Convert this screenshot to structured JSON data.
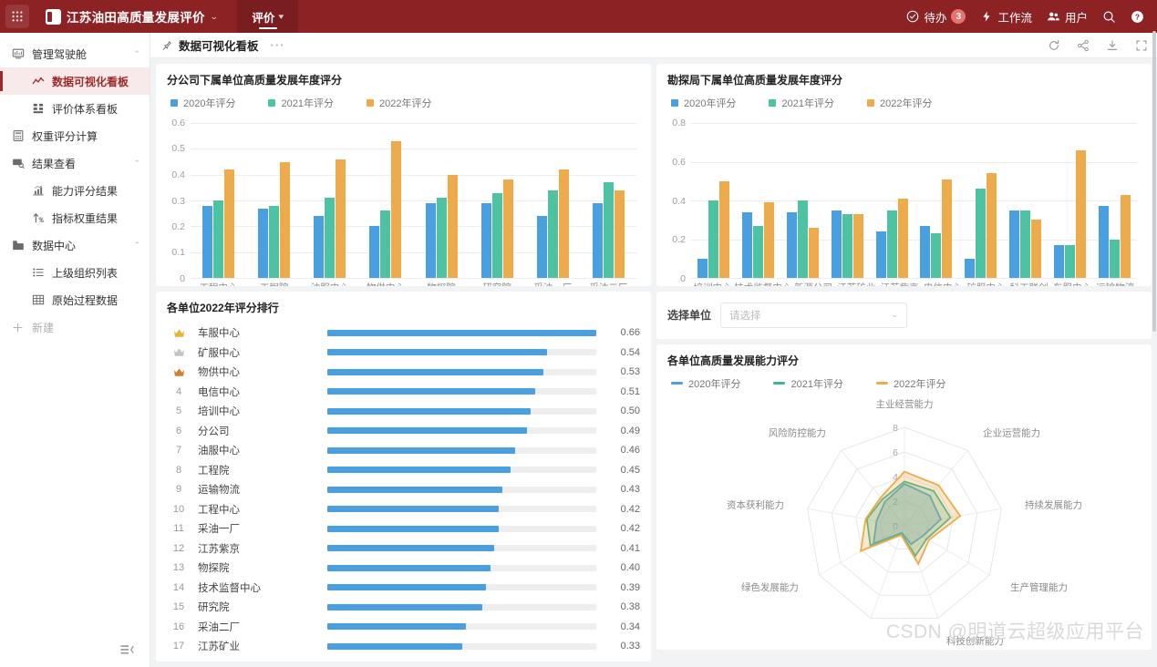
{
  "header": {
    "grid_icon": "apps-grid-icon",
    "app_name": "江苏油田高质量发展评价",
    "app_caret": "⌄",
    "tab_label": "评价",
    "tab_caret": "▾",
    "todo_label": "待办",
    "todo_count": "3",
    "workflow_label": "工作流",
    "user_label": "用户",
    "search_icon": "search-icon",
    "help_icon": "help-icon",
    "bg_color": "#8d2225"
  },
  "sidebar": {
    "items": [
      {
        "label": "管理驾驶舱",
        "icon": "dashboard-icon",
        "level": "group",
        "active": false,
        "arrow": "⌃"
      },
      {
        "label": "数据可视化看板",
        "icon": "chart-line-icon",
        "level": "child",
        "active": true,
        "arrow": ""
      },
      {
        "label": "评价体系看板",
        "icon": "grid-blocks-icon",
        "level": "child",
        "active": false,
        "arrow": ""
      },
      {
        "label": "权重评分计算",
        "icon": "calculator-icon",
        "level": "group",
        "active": false,
        "arrow": ""
      },
      {
        "label": "结果查看",
        "icon": "monitor-search-icon",
        "level": "group",
        "active": false,
        "arrow": "⌃"
      },
      {
        "label": "能力评分结果",
        "icon": "bar-chart-up-icon",
        "level": "child",
        "active": false,
        "arrow": ""
      },
      {
        "label": "指标权重结果",
        "icon": "arrow-up-percent-icon",
        "level": "child",
        "active": false,
        "arrow": ""
      },
      {
        "label": "数据中心",
        "icon": "folder-icon",
        "level": "group",
        "active": false,
        "arrow": "⌃"
      },
      {
        "label": "上级组织列表",
        "icon": "list-icon",
        "level": "child",
        "active": false,
        "arrow": ""
      },
      {
        "label": "原始过程数据",
        "icon": "table-icon",
        "level": "child",
        "active": false,
        "arrow": ""
      },
      {
        "label": "新建",
        "icon": "plus-icon",
        "level": "group",
        "active": false,
        "arrow": ""
      }
    ],
    "collapse_icon": "collapse-sidebar-icon"
  },
  "crumb": {
    "pin_icon": "pin-icon",
    "title": "数据可视化看板",
    "more": "···",
    "refresh_icon": "refresh-icon",
    "share_icon": "share-icon",
    "download_icon": "download-icon",
    "fullscreen_icon": "fullscreen-icon"
  },
  "colors": {
    "series_2020": "#4a9fe0",
    "series_2021": "#4ec3a4",
    "series_2022": "#eeab4c",
    "bar_track": "#eeeeee",
    "brand": "#8d2225"
  },
  "filter": {
    "label": "选择单位",
    "placeholder": "请选择",
    "caret": "⌄"
  },
  "watermark": "CSDN @明道云超级应用平台",
  "chart_data": [
    {
      "id": "branch-annual-scores",
      "type": "bar",
      "title": "分公司下属单位高质量发展年度评分",
      "categories": [
        "工程中心",
        "工程院",
        "油服中心",
        "物供中心",
        "物探院",
        "研究院",
        "采油一厂",
        "采油二厂"
      ],
      "series": [
        {
          "name": "2020年评分",
          "color": "#4a9fe0",
          "values": [
            0.28,
            0.27,
            0.24,
            0.2,
            0.29,
            0.29,
            0.24,
            0.29
          ]
        },
        {
          "name": "2021年评分",
          "color": "#4ec3a4",
          "values": [
            0.3,
            0.28,
            0.31,
            0.26,
            0.31,
            0.33,
            0.34,
            0.37
          ]
        },
        {
          "name": "2022年评分",
          "color": "#eeab4c",
          "values": [
            0.42,
            0.45,
            0.46,
            0.53,
            0.4,
            0.38,
            0.42,
            0.34
          ]
        }
      ],
      "yticks": [
        0,
        0.1,
        0.2,
        0.3,
        0.4,
        0.5,
        0.6
      ],
      "ytick_labels": [
        "0",
        "0.1",
        "0.2",
        "0.3",
        "0.4",
        "0.5",
        "0.6"
      ],
      "ylim": [
        0,
        0.6
      ],
      "grid": true,
      "legend_position": "top-left"
    },
    {
      "id": "bureau-annual-scores",
      "type": "bar",
      "title": "勘探局下属单位高质量发展年度评分",
      "categories": [
        "培训中心",
        "技术监督中心",
        "新源公司",
        "江苏矿业",
        "江苏紫京",
        "电信中心",
        "矿服中心",
        "科工联创",
        "车服中心",
        "运输物流"
      ],
      "series": [
        {
          "name": "2020年评分",
          "color": "#4a9fe0",
          "values": [
            0.1,
            0.34,
            0.34,
            0.35,
            0.24,
            0.27,
            0.1,
            0.35,
            0.17,
            0.37
          ]
        },
        {
          "name": "2021年评分",
          "color": "#4ec3a4",
          "values": [
            0.4,
            0.27,
            0.4,
            0.33,
            0.35,
            0.23,
            0.46,
            0.35,
            0.17,
            0.2
          ]
        },
        {
          "name": "2022年评分",
          "color": "#eeab4c",
          "values": [
            0.5,
            0.39,
            0.26,
            0.33,
            0.41,
            0.51,
            0.54,
            0.3,
            0.66,
            0.43
          ]
        }
      ],
      "yticks": [
        0,
        0.2,
        0.4,
        0.6,
        0.8
      ],
      "ytick_labels": [
        "0",
        "0.2",
        "0.4",
        "0.6",
        "0.8"
      ],
      "ylim": [
        0,
        0.8
      ],
      "grid": true,
      "legend_position": "top-left"
    },
    {
      "id": "unit-2022-ranking",
      "type": "bar",
      "orientation": "horizontal",
      "title": "各单位2022年评分排行",
      "max_value": 0.66,
      "rows": [
        {
          "rank": "1",
          "medal": "gold",
          "name": "车服中心",
          "value": "0.66",
          "num": 0.66
        },
        {
          "rank": "2",
          "medal": "silver",
          "name": "矿服中心",
          "value": "0.54",
          "num": 0.54
        },
        {
          "rank": "3",
          "medal": "bronze",
          "name": "物供中心",
          "value": "0.53",
          "num": 0.53
        },
        {
          "rank": "4",
          "medal": "",
          "name": "电信中心",
          "value": "0.51",
          "num": 0.51
        },
        {
          "rank": "5",
          "medal": "",
          "name": "培训中心",
          "value": "0.50",
          "num": 0.5
        },
        {
          "rank": "6",
          "medal": "",
          "name": "分公司",
          "value": "0.49",
          "num": 0.49
        },
        {
          "rank": "7",
          "medal": "",
          "name": "油服中心",
          "value": "0.46",
          "num": 0.46
        },
        {
          "rank": "8",
          "medal": "",
          "name": "工程院",
          "value": "0.45",
          "num": 0.45
        },
        {
          "rank": "9",
          "medal": "",
          "name": "运输物流",
          "value": "0.43",
          "num": 0.43
        },
        {
          "rank": "10",
          "medal": "",
          "name": "工程中心",
          "value": "0.42",
          "num": 0.42
        },
        {
          "rank": "11",
          "medal": "",
          "name": "采油一厂",
          "value": "0.42",
          "num": 0.42
        },
        {
          "rank": "12",
          "medal": "",
          "name": "江苏紫京",
          "value": "0.41",
          "num": 0.41
        },
        {
          "rank": "13",
          "medal": "",
          "name": "物探院",
          "value": "0.40",
          "num": 0.4
        },
        {
          "rank": "14",
          "medal": "",
          "name": "技术监督中心",
          "value": "0.39",
          "num": 0.39
        },
        {
          "rank": "15",
          "medal": "",
          "name": "研究院",
          "value": "0.38",
          "num": 0.38
        },
        {
          "rank": "16",
          "medal": "",
          "name": "采油二厂",
          "value": "0.34",
          "num": 0.34
        },
        {
          "rank": "17",
          "medal": "",
          "name": "江苏矿业",
          "value": "0.33",
          "num": 0.33
        }
      ]
    },
    {
      "id": "capability-radar",
      "type": "radar",
      "title": "各单位高质量发展能力评分",
      "axes": [
        "主业经营能力",
        "企业运营能力",
        "持续发展能力",
        "生产管理能力",
        "科技创新能力",
        "绿色发展能力",
        "资本获利能力",
        "风险防控能力"
      ],
      "axes_count": 9,
      "ticks": [
        0,
        2,
        4,
        6,
        8
      ],
      "max": 8,
      "series": [
        {
          "name": "2020年评分",
          "color": "#4a9fe0",
          "values": [
            3.4,
            3.2,
            3.0,
            1.7,
            1.6,
            0.6,
            2.9,
            2.3,
            2.5
          ]
        },
        {
          "name": "2021年评分",
          "color": "#3ab795",
          "values": [
            3.6,
            3.7,
            3.8,
            2.1,
            2.6,
            0.7,
            3.2,
            3.1,
            2.8
          ]
        },
        {
          "name": "2022年评分",
          "color": "#eeab4c",
          "values": [
            4.4,
            4.3,
            4.6,
            2.3,
            3.3,
            0.8,
            4.1,
            3.2,
            3.0
          ]
        }
      ],
      "legend_position": "top-left"
    }
  ]
}
